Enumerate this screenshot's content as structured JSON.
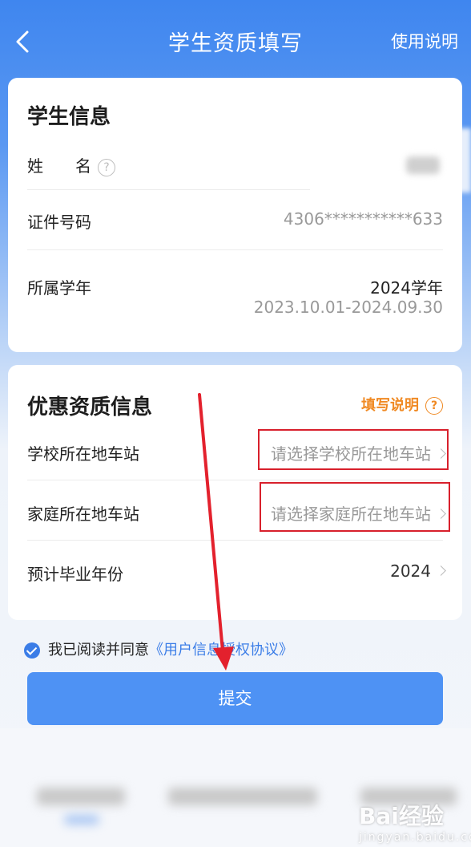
{
  "nav": {
    "title": "学生资质填写",
    "help": "使用说明"
  },
  "student": {
    "section_title": "学生信息",
    "name_label": "姓　　名",
    "id_label": "证件号码",
    "id_value": "4306***********633",
    "year_label": "所属学年",
    "year_value": "2024学年",
    "year_range": "2023.10.01-2024.09.30"
  },
  "discount": {
    "section_title": "优惠资质信息",
    "fill_help": "填写说明",
    "school_label": "学校所在地车站",
    "school_placeholder": "请选择学校所在地车站",
    "home_label": "家庭所在地车站",
    "home_placeholder": "请选择家庭所在地车站",
    "grad_label": "预计毕业年份",
    "grad_value": "2024"
  },
  "agreement": {
    "text": "我已阅读并同意",
    "link": "《用户信息授权协议》"
  },
  "submit_label": "提交",
  "watermark": {
    "brand": "Bai经验",
    "sub": "jingyan.baidu.com"
  },
  "colors": {
    "primary": "#4e92f4",
    "accent_orange": "#f08a24",
    "annotation_red": "#d8202c"
  }
}
